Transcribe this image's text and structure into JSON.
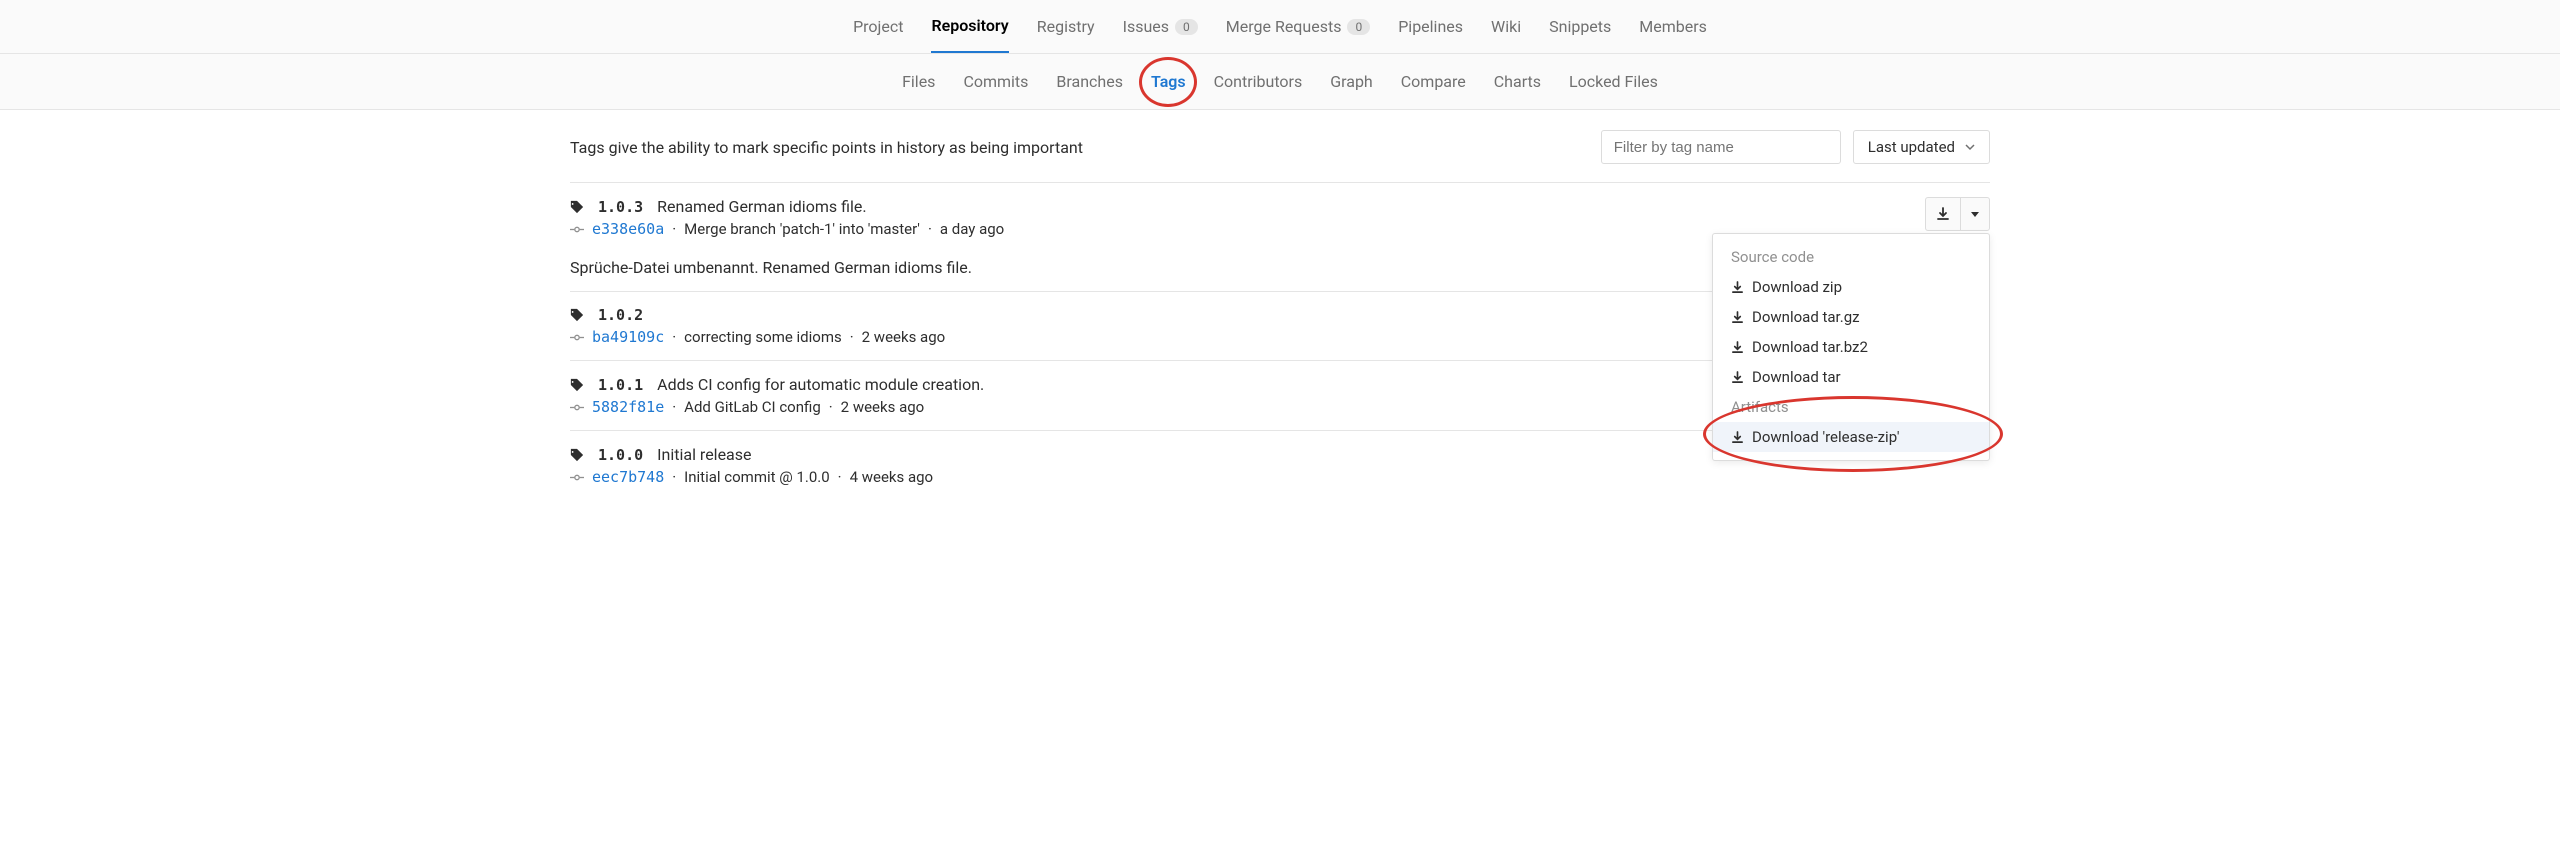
{
  "top_nav": {
    "items": [
      {
        "label": "Project"
      },
      {
        "label": "Repository",
        "active": true
      },
      {
        "label": "Registry"
      },
      {
        "label": "Issues",
        "badge": "0"
      },
      {
        "label": "Merge Requests",
        "badge": "0"
      },
      {
        "label": "Pipelines"
      },
      {
        "label": "Wiki"
      },
      {
        "label": "Snippets"
      },
      {
        "label": "Members"
      }
    ]
  },
  "sub_nav": {
    "items": [
      {
        "label": "Files"
      },
      {
        "label": "Commits"
      },
      {
        "label": "Branches"
      },
      {
        "label": "Tags",
        "active": true,
        "circled": true
      },
      {
        "label": "Contributors"
      },
      {
        "label": "Graph"
      },
      {
        "label": "Compare"
      },
      {
        "label": "Charts"
      },
      {
        "label": "Locked Files"
      }
    ]
  },
  "header": {
    "description": "Tags give the ability to mark specific points in history as being important",
    "filter_placeholder": "Filter by tag name",
    "sort_label": "Last updated"
  },
  "tags": [
    {
      "name": "1.0.3",
      "title": "Renamed German idioms file.",
      "sha": "e338e60a",
      "commit_msg": "Merge branch 'patch-1' into 'master'",
      "time": "a day ago",
      "notes": "Sprüche-Datei umbenannt. Renamed German idioms file.",
      "has_download": true
    },
    {
      "name": "1.0.2",
      "title": "",
      "sha": "ba49109c",
      "commit_msg": "correcting some idioms",
      "time": "2 weeks ago"
    },
    {
      "name": "1.0.1",
      "title": "Adds CI config for automatic module creation.",
      "sha": "5882f81e",
      "commit_msg": "Add GitLab CI config",
      "time": "2 weeks ago"
    },
    {
      "name": "1.0.0",
      "title": "Initial release",
      "sha": "eec7b748",
      "commit_msg": "Initial commit @ 1.0.0",
      "time": "4 weeks ago"
    }
  ],
  "dropdown": {
    "section1_header": "Source code",
    "items1": [
      {
        "label": "Download zip"
      },
      {
        "label": "Download tar.gz"
      },
      {
        "label": "Download tar.bz2"
      },
      {
        "label": "Download tar"
      }
    ],
    "section2_header": "Artifacts",
    "items2": [
      {
        "label": "Download 'release-zip'",
        "highlighted": true
      }
    ]
  }
}
